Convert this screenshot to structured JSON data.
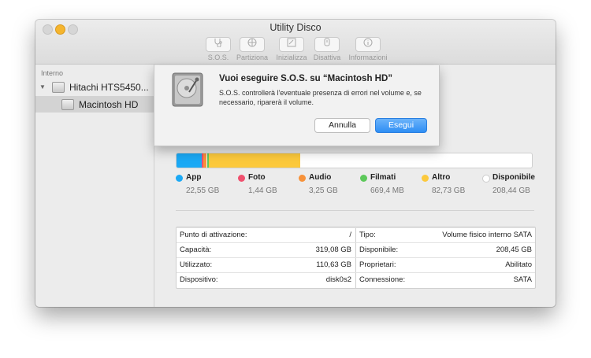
{
  "window": {
    "title": "Utility Disco"
  },
  "toolbar": {
    "items": [
      {
        "label": "S.O.S.",
        "icon": "stethoscope-icon"
      },
      {
        "label": "Partiziona",
        "icon": "partition-icon"
      },
      {
        "label": "Inizializza",
        "icon": "erase-icon"
      },
      {
        "label": "Disattiva",
        "icon": "unmount-icon"
      },
      {
        "label": "Informazioni",
        "icon": "info-icon"
      }
    ]
  },
  "sidebar": {
    "section": "Interno",
    "disk": {
      "label": "Hitachi HTS5450..."
    },
    "volume": {
      "label": "Macintosh HD"
    }
  },
  "dialog": {
    "title": "Vuoi eseguire S.O.S. su “Macintosh HD”",
    "message": "S.O.S. controllerà l'eventuale presenza di errori nel volume e, se necessario, riparerà il volume.",
    "cancel_label": "Annulla",
    "ok_label": "Esegui"
  },
  "usage": {
    "legend": [
      {
        "name": "App",
        "value": "22,55 GB",
        "color": "#1ba9f5"
      },
      {
        "name": "Foto",
        "value": "1,44 GB",
        "color": "#f0506e"
      },
      {
        "name": "Audio",
        "value": "3,25 GB",
        "color": "#f7923a"
      },
      {
        "name": "Filmati",
        "value": "669,4 MB",
        "color": "#5cc85a"
      },
      {
        "name": "Altro",
        "value": "82,73 GB",
        "color": "#fcc93c"
      },
      {
        "name": "Disponibile",
        "value": "208,44 GB",
        "color": "#ffffff"
      }
    ],
    "bar_segments": [
      {
        "category": "App",
        "gb": 22.55,
        "color": "#1ba9f5"
      },
      {
        "category": "Foto",
        "gb": 1.44,
        "color": "#f0506e"
      },
      {
        "category": "Audio",
        "gb": 3.25,
        "color": "#f7923a"
      },
      {
        "category": "Filmati",
        "gb": 0.67,
        "color": "#5cc85a"
      },
      {
        "category": "Altro",
        "gb": 82.73,
        "color": "#fcc93c"
      }
    ],
    "total_gb": 319.08
  },
  "info": {
    "rows": [
      {
        "left_label": "Punto di attivazione:",
        "left_value": "/",
        "right_label": "Tipo:",
        "right_value": "Volume fisico interno SATA"
      },
      {
        "left_label": "Capacità:",
        "left_value": "319,08 GB",
        "right_label": "Disponibile:",
        "right_value": "208,45 GB"
      },
      {
        "left_label": "Utilizzato:",
        "left_value": "110,63 GB",
        "right_label": "Proprietari:",
        "right_value": "Abilitato"
      },
      {
        "left_label": "Dispositivo:",
        "left_value": "disk0s2",
        "right_label": "Connessione:",
        "right_value": "SATA"
      }
    ]
  }
}
